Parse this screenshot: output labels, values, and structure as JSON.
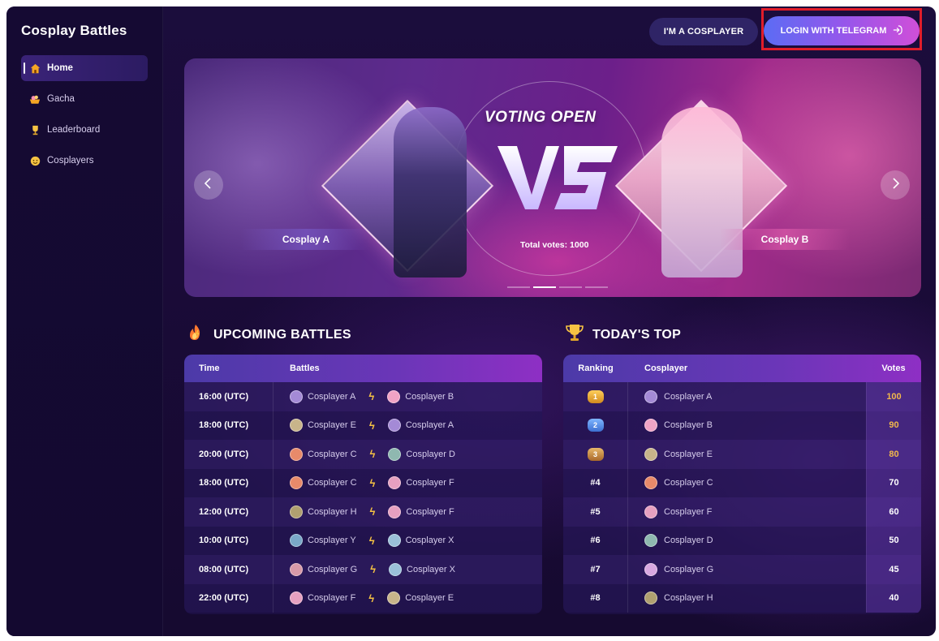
{
  "app": {
    "brand": "Cosplay Battles"
  },
  "sidebar": {
    "items": [
      {
        "label": "Home",
        "icon": "home-icon",
        "active": true
      },
      {
        "label": "Gacha",
        "icon": "gacha-icon"
      },
      {
        "label": "Leaderboard",
        "icon": "trophy-icon"
      },
      {
        "label": "Cosplayers",
        "icon": "cosplayer-icon"
      }
    ]
  },
  "header": {
    "cosplayer_button": "I'M A COSPLAYER",
    "login_button": "LOGIN WITH TELEGRAM"
  },
  "banner": {
    "title": "VOTING OPEN",
    "vs": "VS",
    "left_label": "Cosplay A",
    "right_label": "Cosplay B",
    "total_votes": "Total votes: 1000"
  },
  "upcoming": {
    "title": "UPCOMING BATTLES",
    "headers": {
      "time": "Time",
      "battles": "Battles"
    },
    "rows": [
      {
        "time": "16:00 (UTC)",
        "a": "Cosplayer A",
        "b": "Cosplayer B"
      },
      {
        "time": "18:00 (UTC)",
        "a": "Cosplayer E",
        "b": "Cosplayer A"
      },
      {
        "time": "20:00 (UTC)",
        "a": "Cosplayer C",
        "b": "Cosplayer D"
      },
      {
        "time": "18:00 (UTC)",
        "a": "Cosplayer C",
        "b": "Cosplayer F"
      },
      {
        "time": "12:00 (UTC)",
        "a": "Cosplayer H",
        "b": "Cosplayer F"
      },
      {
        "time": "10:00 (UTC)",
        "a": "Cosplayer Y",
        "b": "Cosplayer X"
      },
      {
        "time": "08:00 (UTC)",
        "a": "Cosplayer G",
        "b": "Cosplayer X"
      },
      {
        "time": "22:00 (UTC)",
        "a": "Cosplayer F",
        "b": "Cosplayer E"
      }
    ]
  },
  "top": {
    "title": "TODAY'S TOP",
    "headers": {
      "ranking": "Ranking",
      "cosplayer": "Cosplayer",
      "votes": "Votes"
    },
    "rows": [
      {
        "rank": "1",
        "name": "Cosplayer A",
        "votes": "100"
      },
      {
        "rank": "2",
        "name": "Cosplayer B",
        "votes": "90"
      },
      {
        "rank": "3",
        "name": "Cosplayer E",
        "votes": "80"
      },
      {
        "rank": "#4",
        "name": "Cosplayer C",
        "votes": "70"
      },
      {
        "rank": "#5",
        "name": "Cosplayer F",
        "votes": "60"
      },
      {
        "rank": "#6",
        "name": "Cosplayer D",
        "votes": "50"
      },
      {
        "rank": "#7",
        "name": "Cosplayer G",
        "votes": "45"
      },
      {
        "rank": "#8",
        "name": "Cosplayer H",
        "votes": "40"
      }
    ]
  },
  "colors": {
    "accent": "#8e2fc4",
    "gold": "#f6c343",
    "vote_gold": "#f2b84b",
    "highlight": "#e11d2a"
  }
}
